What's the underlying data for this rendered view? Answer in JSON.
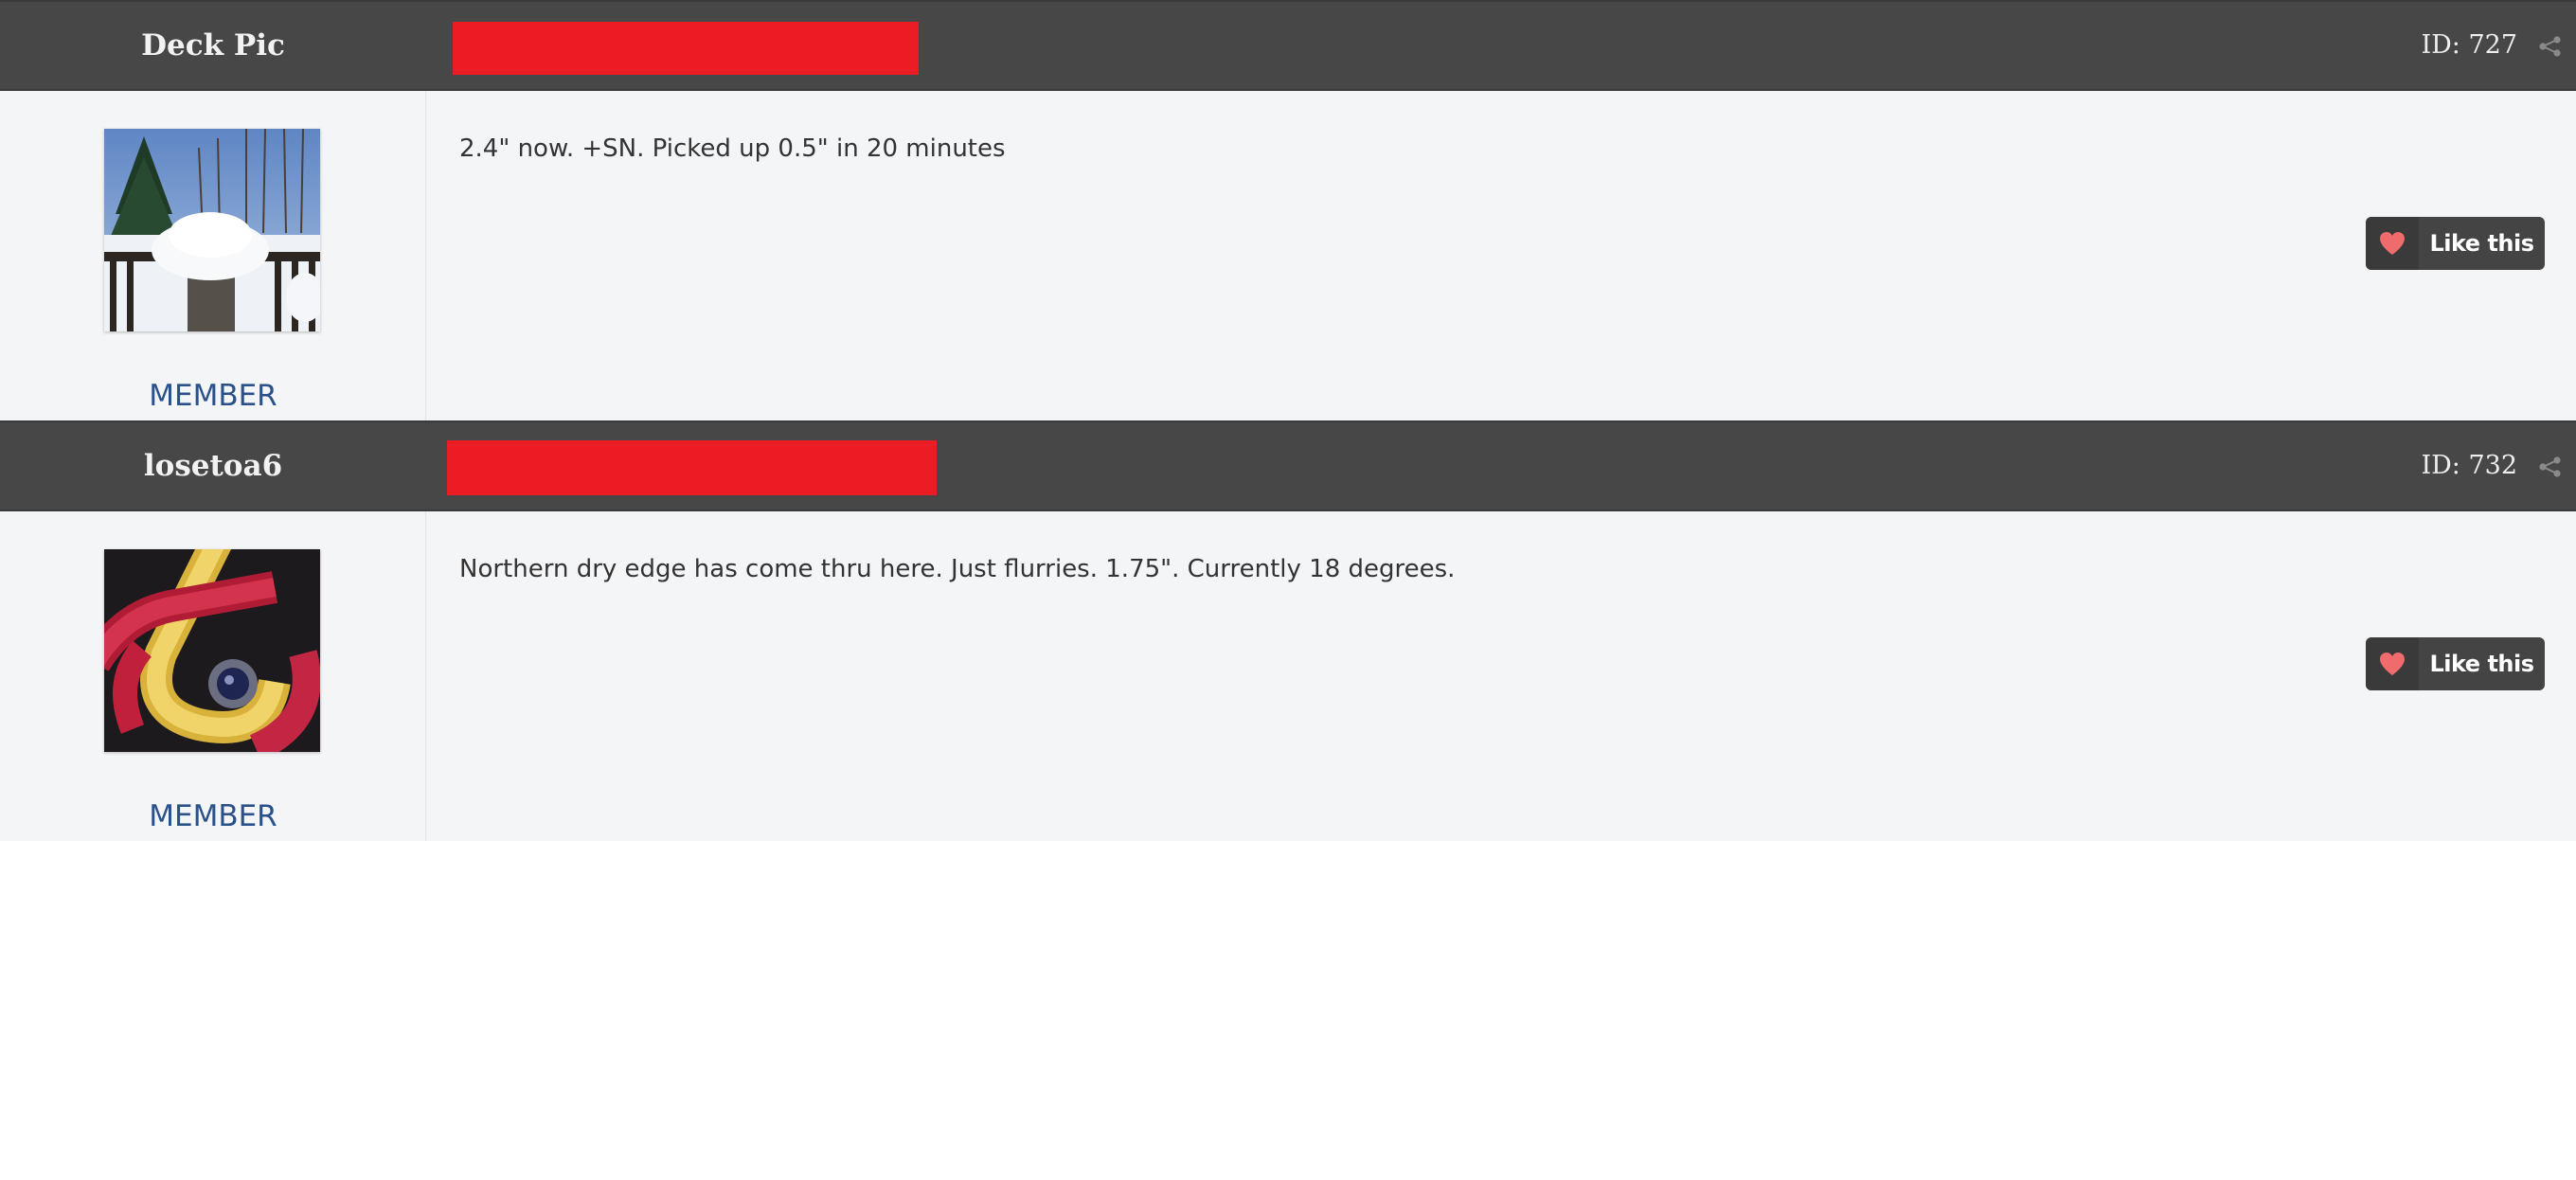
{
  "posts": [
    {
      "username": "Deck Pic",
      "post_id": "ID: 727",
      "role": "MEMBER",
      "content": "2.4\" now. +SN. Picked up 0.5\" in 20 minutes",
      "like_label": "Like this",
      "avatar_icon": "snowy-deck-grill-photo"
    },
    {
      "username": "losetoa6",
      "post_id": "ID: 732",
      "role": "MEMBER",
      "content": "Northern dry edge has come thru here. Just flurries. 1.75\". Currently 18 degrees.",
      "like_label": "Like this",
      "avatar_icon": "buick-logo-emblem-photo"
    }
  ],
  "colors": {
    "header_bg": "#474747",
    "body_bg": "#f4f5f7",
    "role_text": "#2a5189",
    "redaction": "#ec1c24",
    "like_heart": "#f06b6b"
  }
}
